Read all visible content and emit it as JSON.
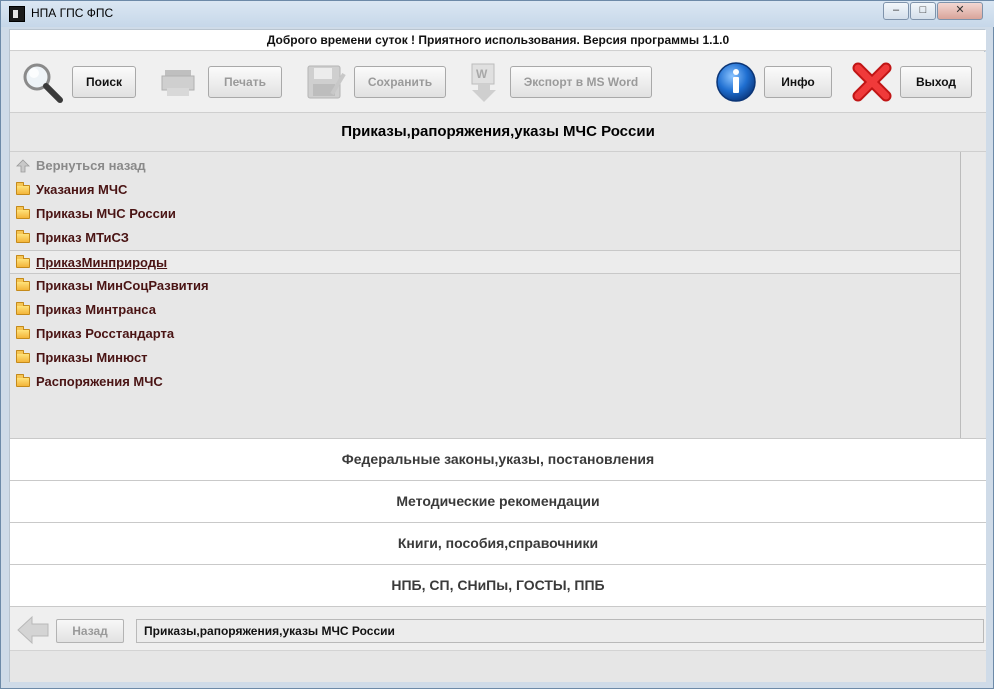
{
  "window": {
    "title": "НПА ГПС ФПС",
    "minimize_label": "–",
    "maximize_label": "□",
    "close_label": "✕"
  },
  "greeting": "Доброго времени суток ! Приятного использования. Версия программы 1.1.0",
  "toolbar": {
    "search_label": "Поиск",
    "print_label": "Печать",
    "save_label": "Сохранить",
    "export_label": "Экспорт в MS Word",
    "info_label": "Инфо",
    "exit_label": "Выход",
    "icons": [
      "magnifier-icon",
      "printer-icon",
      "floppy-disk-icon",
      "word-export-icon",
      "info-icon",
      "red-x-icon"
    ]
  },
  "section_header": "Приказы,рапоряжения,указы МЧС России",
  "list": {
    "back_item": "Вернуться назад",
    "items": [
      "Указания МЧС",
      "Приказы МЧС России",
      "Приказ МТиСЗ",
      "ПриказМинприроды",
      "Приказы МинСоцРазвития",
      "Приказ Минтранса",
      "Приказ Росстандарта",
      "Приказы Минюст",
      "Распоряжения МЧС"
    ],
    "selected_index": 3
  },
  "categories": [
    "Федеральные законы,указы, постановления",
    "Методические рекомендации",
    "Книги, пособия,справочники",
    "НПБ, СП, СНиПы, ГОСТЫ, ППБ"
  ],
  "bottom": {
    "back_label": "Назад",
    "current_path": "Приказы,рапоряжения,указы МЧС России"
  },
  "colors": {
    "info_blue": "#1f6fd1",
    "exit_red": "#e02020",
    "folder_yellow": "#f3b53a",
    "item_text": "#4a1414"
  }
}
